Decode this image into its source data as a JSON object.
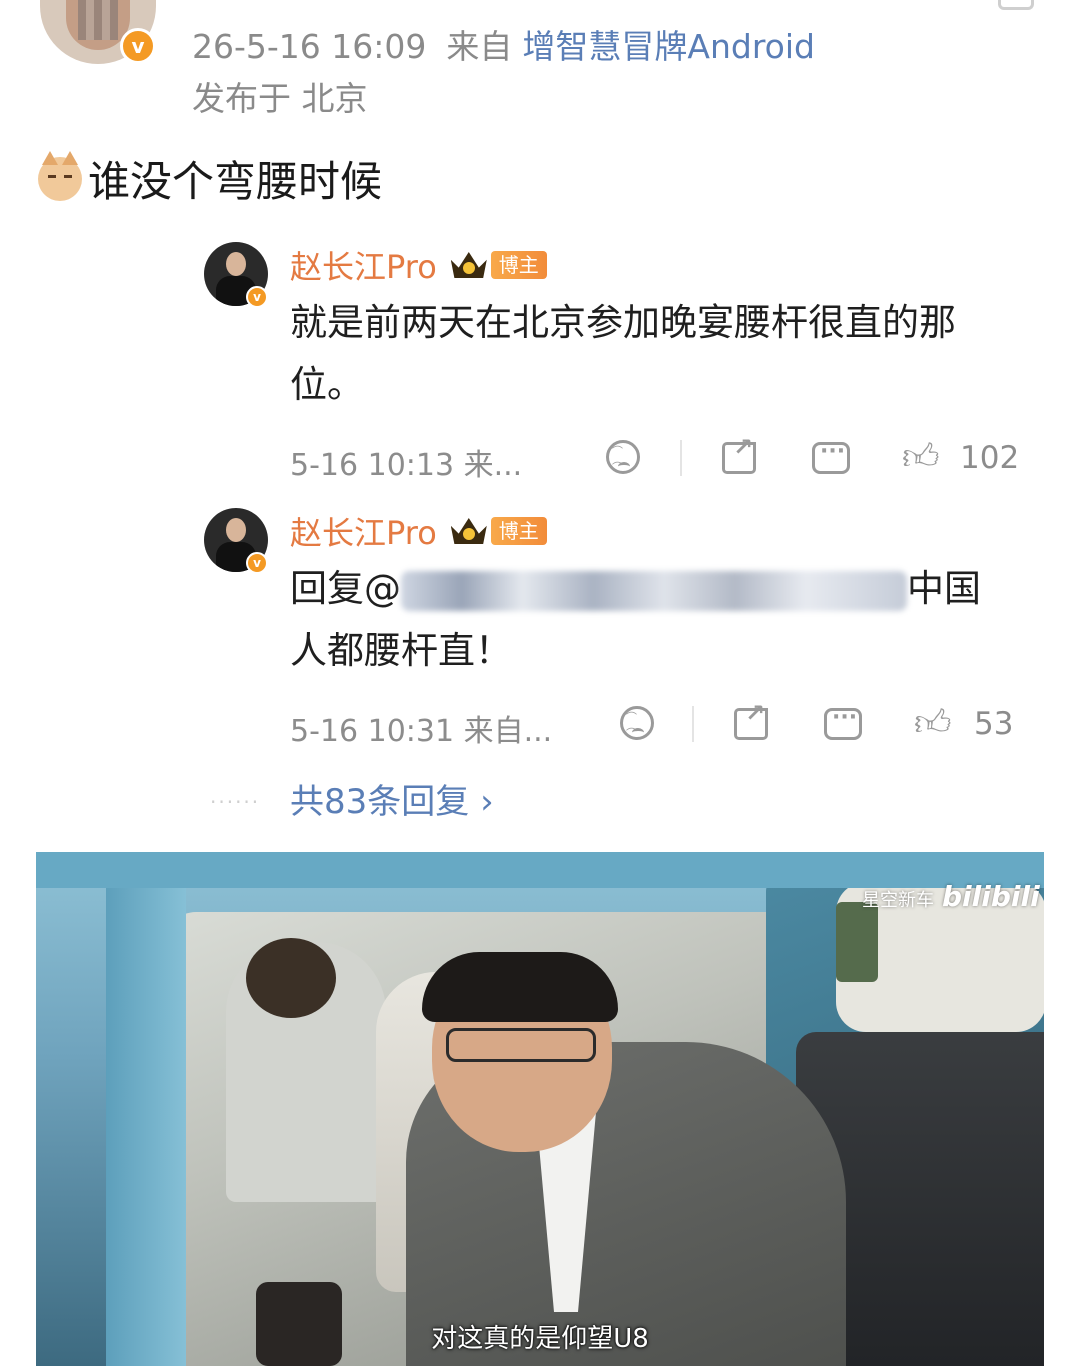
{
  "post": {
    "timestamp": "26-5-16 16:09",
    "source_prefix": "来自",
    "source_device": "增智慧冒牌Android",
    "location": "发布于 北京",
    "text": "谁没个弯腰时候",
    "emoji_icon": "cat-face-icon"
  },
  "comments": [
    {
      "author": "赵长江Pro",
      "badge": "博主",
      "text": "就是前两天在北京参加晚宴腰杆很直的那位。",
      "meta": "5-16 10:13 来...",
      "likes": "102"
    },
    {
      "author": "赵长江Pro",
      "badge": "博主",
      "text_prefix": "回复@",
      "text_suffix": "中国人都腰杆直！",
      "meta": "5-16 10:31 来自...",
      "likes": "53"
    }
  ],
  "replies": {
    "dots": "......",
    "total_label": "共83条回复 ›"
  },
  "photo": {
    "watermark_text": "星空新车",
    "watermark_brand": "bilibili",
    "subtitle": "对这真的是仰望U8"
  },
  "colors": {
    "author": "#e47a42",
    "link": "#5a7eb6",
    "meta": "#8c8c8c",
    "verified": "#f49a24"
  }
}
